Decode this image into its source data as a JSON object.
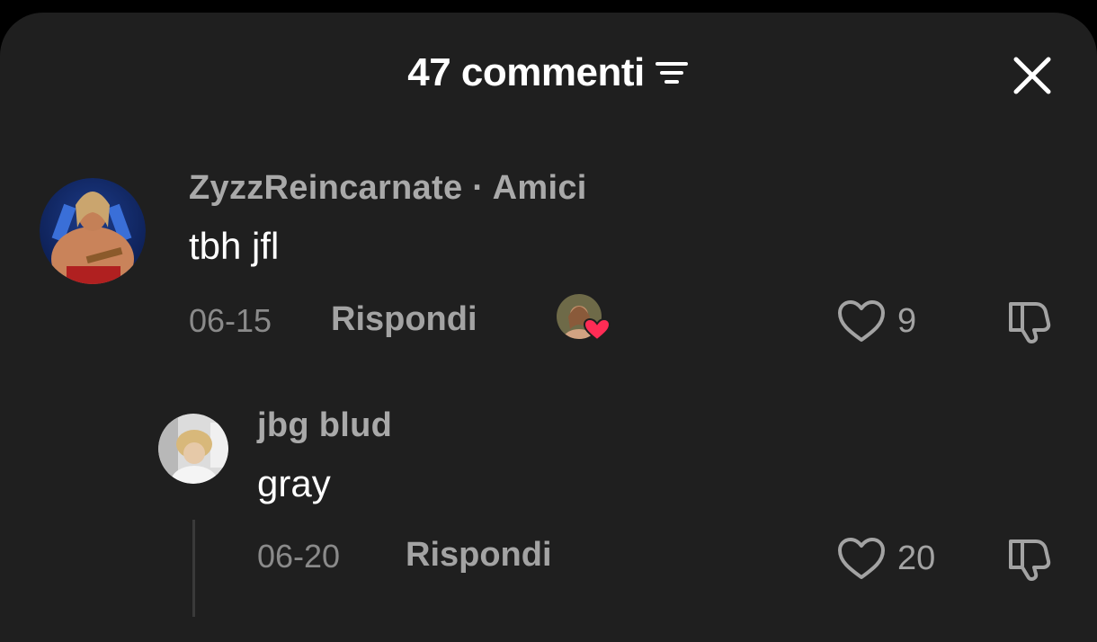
{
  "header": {
    "title": "47 commenti",
    "sort_icon": "sort-lines-icon",
    "close_icon": "close-icon"
  },
  "comments": [
    {
      "username": "ZyzzReincarnate",
      "separator": " · ",
      "badge": "Amici",
      "text": "tbh jfl",
      "date": "06-15",
      "reply_label": "Rispondi",
      "creator_liked": true,
      "likes": "9"
    },
    {
      "username": "jbg blud",
      "text": "gray",
      "date": "06-20",
      "reply_label": "Rispondi",
      "likes": "20"
    }
  ],
  "colors": {
    "background": "#1f1f1f",
    "heart_badge": "#fe2c55"
  }
}
